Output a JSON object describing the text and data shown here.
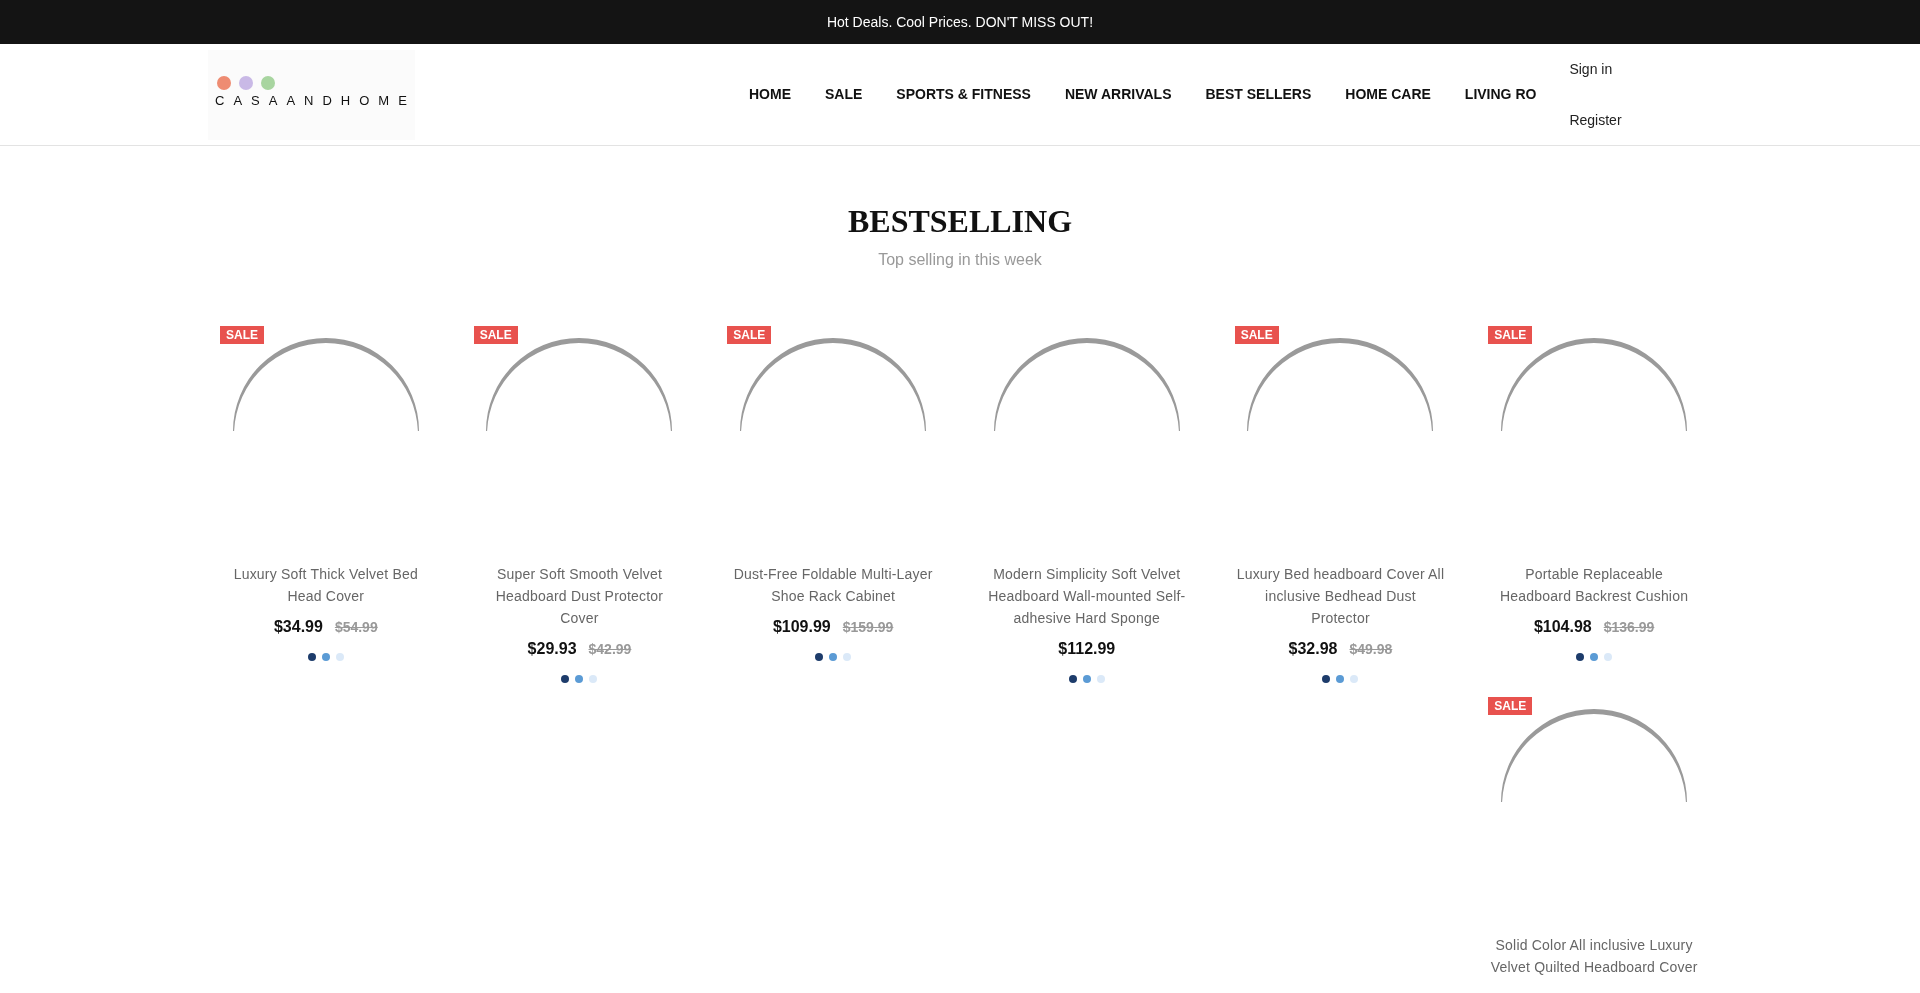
{
  "announcement_bar": {
    "text": "Hot Deals. Cool Prices. DON'T MISS OUT!"
  },
  "header": {
    "logo": {
      "text": "CASAANDHOME"
    },
    "nav": [
      "HOME",
      "SALE",
      "SPORTS & FITNESS",
      "NEW ARRIVALS",
      "BEST SELLERS",
      "HOME CARE",
      "LIVING RO"
    ],
    "account_links": [
      "Sign in",
      "Register"
    ]
  },
  "section": {
    "title": "BESTSELLING",
    "subtitle": "Top selling in this week"
  },
  "products": [
    {
      "badge": "SALE",
      "title": "Luxury Soft Thick Velvet Bed Head Cover",
      "price": "$34.99",
      "compare_price": "$54.99",
      "swatches": [
        {
          "color": "#1d3c6b"
        },
        {
          "color": "#5b9bd5"
        },
        {
          "color": "#dbe9f8"
        }
      ]
    },
    {
      "badge": "SALE",
      "title": "Super Soft Smooth Velvet Headboard Dust Protector Cover",
      "price": "$29.93",
      "compare_price": "$42.99",
      "swatches": [
        {
          "color": "#1d3c6b"
        },
        {
          "color": "#5b9bd5"
        },
        {
          "color": "#dbe9f8"
        }
      ]
    },
    {
      "badge": "SALE",
      "title": "Dust-Free Foldable Multi-Layer Shoe Rack Cabinet",
      "price": "$109.99",
      "compare_price": "$159.99",
      "swatches": [
        {
          "color": "#1d3c6b"
        },
        {
          "color": "#5b9bd5"
        },
        {
          "color": "#dbe9f8"
        }
      ]
    },
    {
      "title": "Modern Simplicity Soft Velvet Headboard Wall-mounted Self-adhesive Hard Sponge",
      "price": "$112.99",
      "swatches": [
        {
          "color": "#1d3c6b"
        },
        {
          "color": "#5b9bd5"
        },
        {
          "color": "#dbe9f8"
        }
      ]
    },
    {
      "badge": "SALE",
      "title": "Luxury Bed headboard Cover All inclusive Bedhead Dust Protector",
      "price": "$32.98",
      "compare_price": "$49.98",
      "swatches": [
        {
          "color": "#1d3c6b"
        },
        {
          "color": "#5b9bd5"
        },
        {
          "color": "#dbe9f8"
        }
      ]
    },
    {
      "badge": "SALE",
      "title": "Portable Replaceable Headboard Backrest Cushion",
      "price": "$104.98",
      "compare_price": "$136.99",
      "swatches": [
        {
          "color": "#1d3c6b"
        },
        {
          "color": "#5b9bd5"
        },
        {
          "color": "#dbe9f8"
        }
      ]
    },
    {
      "badge": "SALE",
      "title": "Solid Color All inclusive Luxury Velvet Quilted Headboard Cover"
    }
  ]
}
